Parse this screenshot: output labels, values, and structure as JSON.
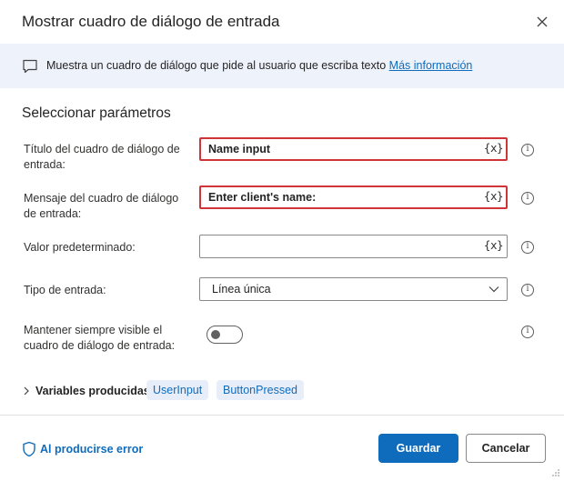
{
  "dialog": {
    "title": "Mostrar cuadro de diálogo de entrada",
    "close_icon": "close-icon"
  },
  "banner": {
    "icon": "message-icon",
    "text": "Muestra un cuadro de diálogo que pide al usuario que escriba texto",
    "link": "Más información"
  },
  "section": {
    "title": "Seleccionar parámetros"
  },
  "params": {
    "dialog_title": {
      "label": "Título del cuadro de diálogo de entrada:",
      "value": "Name input",
      "var_button": "{x}",
      "has_error": true
    },
    "dialog_message": {
      "label": "Mensaje del cuadro de diálogo de entrada:",
      "value": "Enter client's name:",
      "var_button": "{x}",
      "has_error": true
    },
    "default_value": {
      "label": "Valor predeterminado:",
      "value": "",
      "var_button": "{x}"
    },
    "input_type": {
      "label": "Tipo de entrada:",
      "value": "Línea única"
    },
    "keep_on_top": {
      "label": "Mantener siempre visible el cuadro de diálogo de entrada:",
      "on": false
    }
  },
  "variables": {
    "label": "Variables producidas",
    "items": [
      "UserInput",
      "ButtonPressed"
    ]
  },
  "footer": {
    "error_link": "Al producirse error",
    "save": "Guardar",
    "cancel": "Cancelar"
  },
  "colors": {
    "accent": "#0f6cbd",
    "error_border": "#d13438",
    "banner_bg": "#eef2fb",
    "chip_bg": "#e8eef9"
  }
}
